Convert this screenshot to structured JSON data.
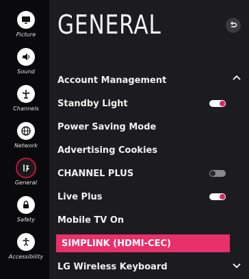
{
  "sidebar": {
    "items": [
      {
        "label": "Picture",
        "icon": "picture-icon",
        "active": false
      },
      {
        "label": "Sound",
        "icon": "speaker-icon",
        "active": false
      },
      {
        "label": "Channels",
        "icon": "antenna-icon",
        "active": false
      },
      {
        "label": "Network",
        "icon": "globe-icon",
        "active": false
      },
      {
        "label": "General",
        "icon": "general-settings-icon",
        "active": true
      },
      {
        "label": "Safety",
        "icon": "lock-icon",
        "active": false
      },
      {
        "label": "Accessibility",
        "icon": "accessibility-icon",
        "active": false
      }
    ]
  },
  "panel": {
    "title": "GENERAL",
    "items": [
      {
        "label": "Account Management",
        "toggle": null
      },
      {
        "label": "Standby Light",
        "toggle": "on"
      },
      {
        "label": "Power Saving Mode",
        "toggle": null
      },
      {
        "label": "Advertising Cookies",
        "toggle": null
      },
      {
        "label": "CHANNEL PLUS",
        "toggle": "off"
      },
      {
        "label": "Live Plus",
        "toggle": "on"
      },
      {
        "label": "Mobile TV On",
        "toggle": null
      },
      {
        "label": "SIMPLINK (HDMI-CEC)",
        "toggle": null,
        "selected": true
      },
      {
        "label": "LG Wireless Keyboard",
        "toggle": null
      }
    ]
  },
  "colors": {
    "accent": "#e8306b",
    "active_ring": "#c8103c",
    "panel_bg": "#1c1c20"
  }
}
